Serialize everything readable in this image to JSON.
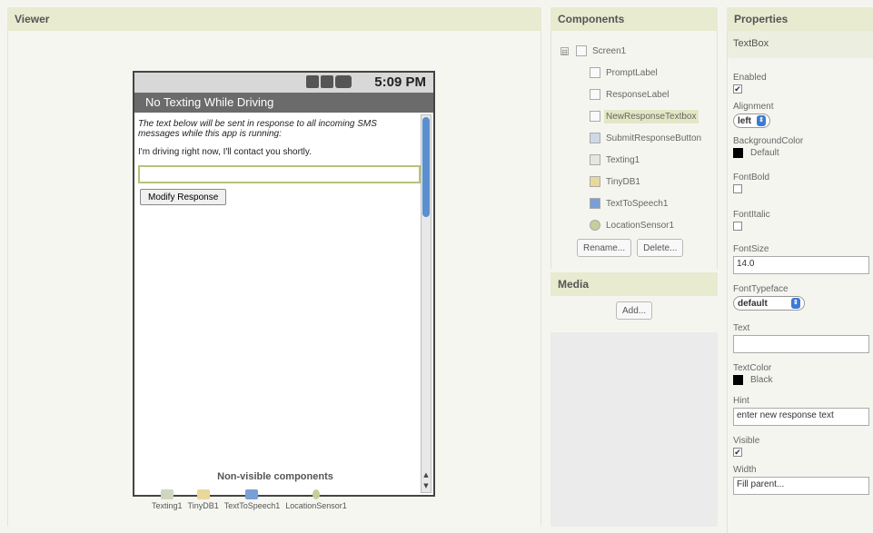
{
  "headers": {
    "viewer": "Viewer",
    "components": "Components",
    "properties": "Properties",
    "media": "Media"
  },
  "phone": {
    "status_time": "5:09 PM",
    "title": "No Texting While Driving",
    "prompt_label": "The text below will be sent in response to all incoming SMS messages while this app is running:",
    "response_label": "I'm driving right now, I'll contact you shortly.",
    "response_textbox_value": "",
    "modify_button": "Modify Response",
    "scroll_up": "▲",
    "scroll_down": "▼"
  },
  "nonvisible": {
    "label": "Non-visible components",
    "items": [
      "Texting1",
      "TinyDB1",
      "TextToSpeech1",
      "LocationSensor1"
    ]
  },
  "components": {
    "collapse_symbol": "⊟",
    "root": "Screen1",
    "children": [
      "PromptLabel",
      "ResponseLabel",
      "NewResponseTextbox",
      "SubmitResponseButton",
      "Texting1",
      "TinyDB1",
      "TextToSpeech1",
      "LocationSensor1"
    ],
    "selected": "NewResponseTextbox",
    "rename_button": "Rename...",
    "delete_button": "Delete..."
  },
  "media": {
    "add_button": "Add..."
  },
  "properties": {
    "component_type": "TextBox",
    "enabled_label": "Enabled",
    "enabled_checked": true,
    "alignment_label": "Alignment",
    "alignment_value": "left",
    "background_label": "BackgroundColor",
    "background_value": "Default",
    "fontbold_label": "FontBold",
    "fontbold_checked": false,
    "fontitalic_label": "FontItalic",
    "fontitalic_checked": false,
    "fontsize_label": "FontSize",
    "fontsize_value": "14.0",
    "fonttypeface_label": "FontTypeface",
    "fonttypeface_value": "default",
    "text_label": "Text",
    "text_value": "",
    "textcolor_label": "TextColor",
    "textcolor_value": "Black",
    "hint_label": "Hint",
    "hint_value": "enter new response text",
    "visible_label": "Visible",
    "visible_checked": true,
    "width_label": "Width",
    "width_value": "Fill parent...",
    "check_mark": "✔"
  },
  "colors": {
    "header_bg": "#e8ebcf",
    "selected_bg": "#e4e7c4",
    "phone_title_bg": "#6b6b6b",
    "accent_blue": "#3d7ad6",
    "textbox_border": "#b8c27a",
    "swatch_default": "#000000",
    "swatch_black": "#000000"
  }
}
